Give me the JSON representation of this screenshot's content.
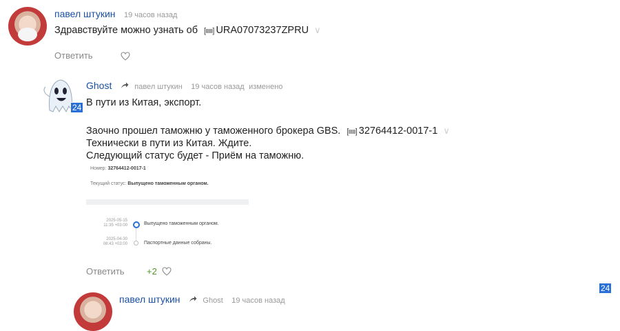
{
  "comments": [
    {
      "author": "павел штукин",
      "time": "19 часов назад",
      "text_before_track": "Здравствуйте можно узнать об",
      "track_number": "URA07073237ZPRU",
      "reply_label": "Ответить"
    },
    {
      "author": "Ghost",
      "reply_to": "павел штукин",
      "time": "19 часов назад",
      "edited": "изменено",
      "badge": "24",
      "line1": "В пути из Китая, экспорт.",
      "line2_before_track": "Заочно прошел таможню у таможенного брокера GBS.",
      "track_number": "32764412-0017-1",
      "line3": "Технически в пути из Китая. Ждите.",
      "line4": "Следующий статус будет - Приём на таможню.",
      "screenshot": {
        "number_label": "Номер:",
        "number_value": "32764412-0017-1",
        "status_label": "Текущий статус:",
        "status_value": "Выпущено таможенным органом.",
        "events": [
          {
            "date": "2025-05-15",
            "time": "11:35 +03:00",
            "text": "Выпущено таможенным органом."
          },
          {
            "date": "2025-04-30",
            "time": "08:43 +03:00",
            "text": "Паспортные данные собраны."
          }
        ]
      },
      "reply_label": "Ответить",
      "likes": "+2"
    },
    {
      "author": "павел штукин",
      "reply_to": "Ghost",
      "time": "19 часов назад"
    }
  ],
  "corner_badge": "24",
  "colors": {
    "author": "#1a4fa3",
    "likes": "#4a9a2a",
    "badge": "#2a6fd6"
  }
}
